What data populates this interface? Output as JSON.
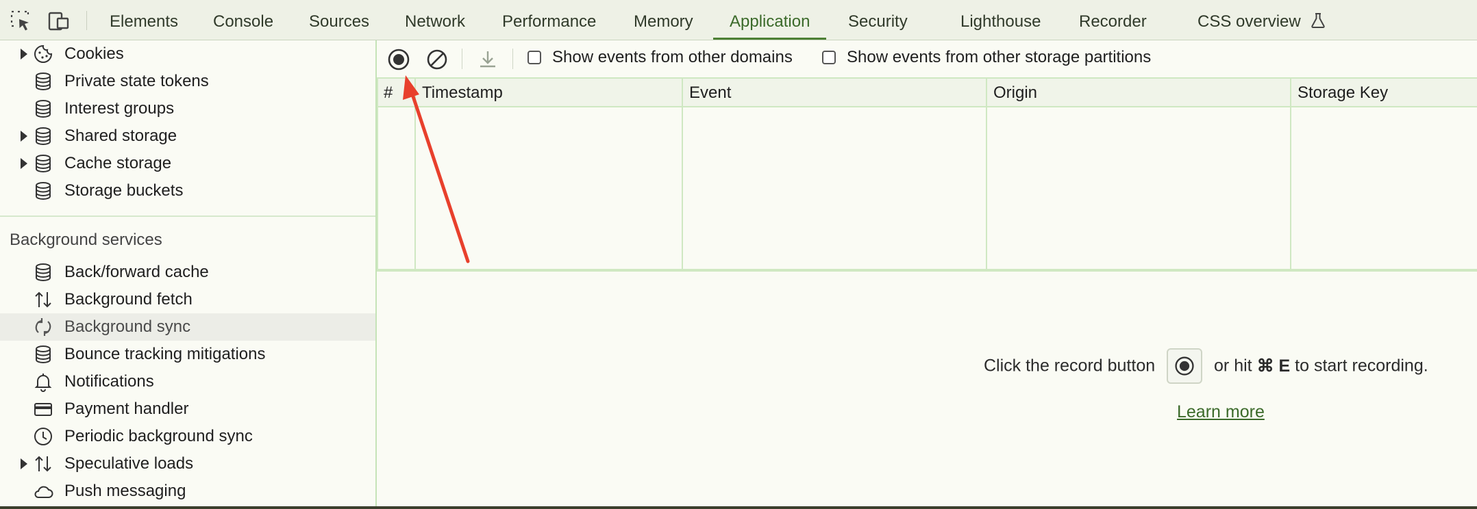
{
  "tabs": [
    "Elements",
    "Console",
    "Sources",
    "Network",
    "Performance",
    "Memory",
    "Application",
    "Security",
    "Lighthouse",
    "Recorder",
    "CSS overview"
  ],
  "active_tab": "Application",
  "icons": {
    "inspect": "inspect-element-icon",
    "device": "device-toggle-icon",
    "flask": "experiment-flask-icon",
    "record": "record-icon",
    "clear": "clear-icon",
    "download": "download-icon"
  },
  "sidebar": {
    "storage_items": [
      {
        "label": "Cookies",
        "expandable": true,
        "icon": "cookie-icon"
      },
      {
        "label": "Private state tokens",
        "expandable": false,
        "icon": "database-icon"
      },
      {
        "label": "Interest groups",
        "expandable": false,
        "icon": "database-icon"
      },
      {
        "label": "Shared storage",
        "expandable": true,
        "icon": "database-icon"
      },
      {
        "label": "Cache storage",
        "expandable": true,
        "icon": "database-icon"
      },
      {
        "label": "Storage buckets",
        "expandable": false,
        "icon": "database-icon"
      }
    ],
    "section_title": "Background services",
    "bg_items": [
      {
        "label": "Back/forward cache",
        "expandable": false,
        "icon": "database-icon"
      },
      {
        "label": "Background fetch",
        "expandable": false,
        "icon": "up-down-arrows-icon"
      },
      {
        "label": "Background sync",
        "expandable": false,
        "icon": "sync-icon",
        "selected": true
      },
      {
        "label": "Bounce tracking mitigations",
        "expandable": false,
        "icon": "database-icon"
      },
      {
        "label": "Notifications",
        "expandable": false,
        "icon": "bell-icon"
      },
      {
        "label": "Payment handler",
        "expandable": false,
        "icon": "credit-card-icon"
      },
      {
        "label": "Periodic background sync",
        "expandable": false,
        "icon": "clock-icon"
      },
      {
        "label": "Speculative loads",
        "expandable": true,
        "icon": "up-down-arrows-icon"
      },
      {
        "label": "Push messaging",
        "expandable": false,
        "icon": "cloud-icon"
      }
    ]
  },
  "toolbar": {
    "checkbox_other_domains": "Show events from other domains",
    "checkbox_other_partitions": "Show events from other storage partitions"
  },
  "table": {
    "headers": [
      "#",
      "Timestamp",
      "Event",
      "Origin",
      "Storage Key"
    ],
    "rows": []
  },
  "empty_state": {
    "prefix": "Click the record button",
    "middle": "or hit",
    "shortcut": "⌘ E",
    "suffix": "to start recording.",
    "link": "Learn more"
  },
  "colors": {
    "accent": "#3b6a2a",
    "annotation_arrow": "#e8402c",
    "selected_row": "#ecede7"
  }
}
